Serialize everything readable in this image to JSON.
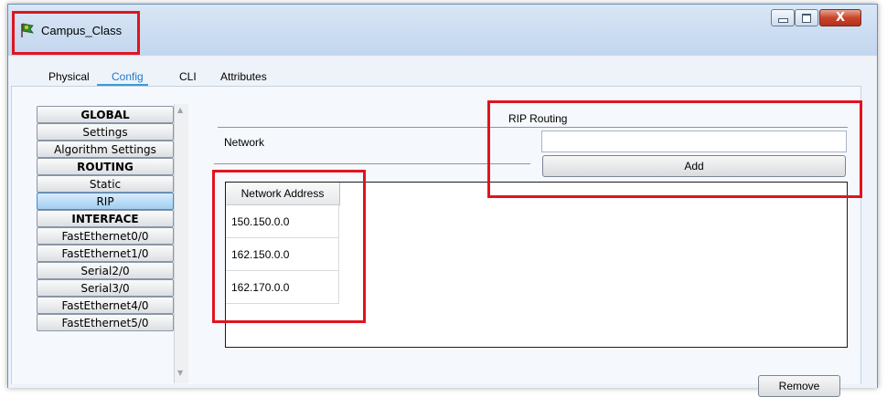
{
  "window": {
    "title": "Campus_Class",
    "icon": "router-flag-icon",
    "controls": [
      "minimize-icon",
      "maximize-icon",
      "close-icon"
    ],
    "close_glyph": "X"
  },
  "tabs": [
    {
      "label": "Physical",
      "active": false
    },
    {
      "label": "Config",
      "active": true
    },
    {
      "label": "CLI",
      "active": false
    },
    {
      "label": "Attributes",
      "active": false
    }
  ],
  "sidebar": {
    "items": [
      {
        "label": "GLOBAL",
        "header": true
      },
      {
        "label": "Settings"
      },
      {
        "label": "Algorithm Settings"
      },
      {
        "label": "ROUTING",
        "header": true
      },
      {
        "label": "Static"
      },
      {
        "label": "RIP",
        "selected": true
      },
      {
        "label": "INTERFACE",
        "header": true
      },
      {
        "label": "FastEthernet0/0"
      },
      {
        "label": "FastEthernet1/0"
      },
      {
        "label": "Serial2/0"
      },
      {
        "label": "Serial3/0"
      },
      {
        "label": "FastEthernet4/0"
      },
      {
        "label": "FastEthernet5/0"
      }
    ]
  },
  "rip": {
    "section_title": "RIP Routing",
    "network_label": "Network",
    "network_value": "",
    "add_label": "Add",
    "table_header": "Network Address",
    "networks": [
      "150.150.0.0",
      "162.150.0.0",
      "162.170.0.0"
    ],
    "remove_label": "Remove"
  },
  "colors": {
    "highlight": "#e0141e",
    "accent_tab": "#1f78c8",
    "selected_item": "#9fcdf2"
  }
}
